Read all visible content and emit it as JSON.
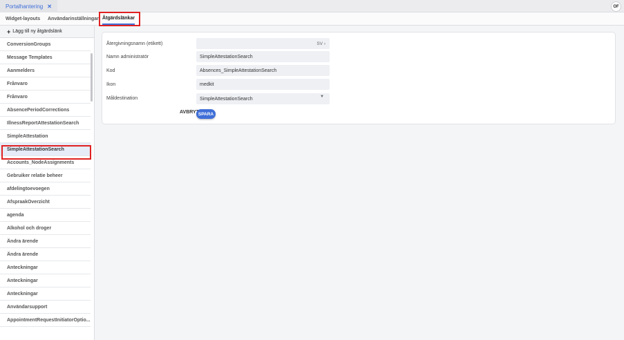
{
  "top_tab": {
    "label": "Portalhantering",
    "close": "✕"
  },
  "user_initials": "OF",
  "subtabs": [
    "Widget-layouts",
    "Användarinställningar",
    "Åtgärdslänkar"
  ],
  "sidebar": {
    "add_label": "Lägg till ny åtgärdslänk",
    "items": [
      "ConversionGroups",
      "Message Templates",
      "Aanmelders",
      "Frånvaro",
      "Frånvaro",
      "AbsencePeriodCorrections",
      "IllnessReportAttestationSearch",
      "SimpleAttestation",
      "SimpleAttestationSearch",
      "Accounts_NodeAssignments",
      "Gebruiker relatie beheer",
      "afdelingtoevoegen",
      "AfspraakOverzicht",
      "agenda",
      "Alkohol och droger",
      "Ändra ärende",
      "Ändra ärende",
      "Anteckningar",
      "Anteckningar",
      "Anteckningar",
      "Användarsupport",
      "AppointmentRequestInitiatorOptio..."
    ]
  },
  "form": {
    "label_display_name": "Återgivningsnamn (etikett)",
    "display_name_value": "",
    "lang": "SV ›",
    "label_admin_name": "Namn administratör",
    "admin_name_value": "SimpleAttestationSearch",
    "label_code": "Kod",
    "code_value": "Absences_SimpleAttestationSearch",
    "label_icon": "Ikon",
    "icon_value": "medkit",
    "label_target": "Måldestination",
    "target_value": "SimpleAttestationSearch",
    "cancel_label": "AVBRYT",
    "save_label": "SPARA"
  },
  "colors": {
    "accent": "#3f6fd8",
    "highlight": "#e02020"
  }
}
